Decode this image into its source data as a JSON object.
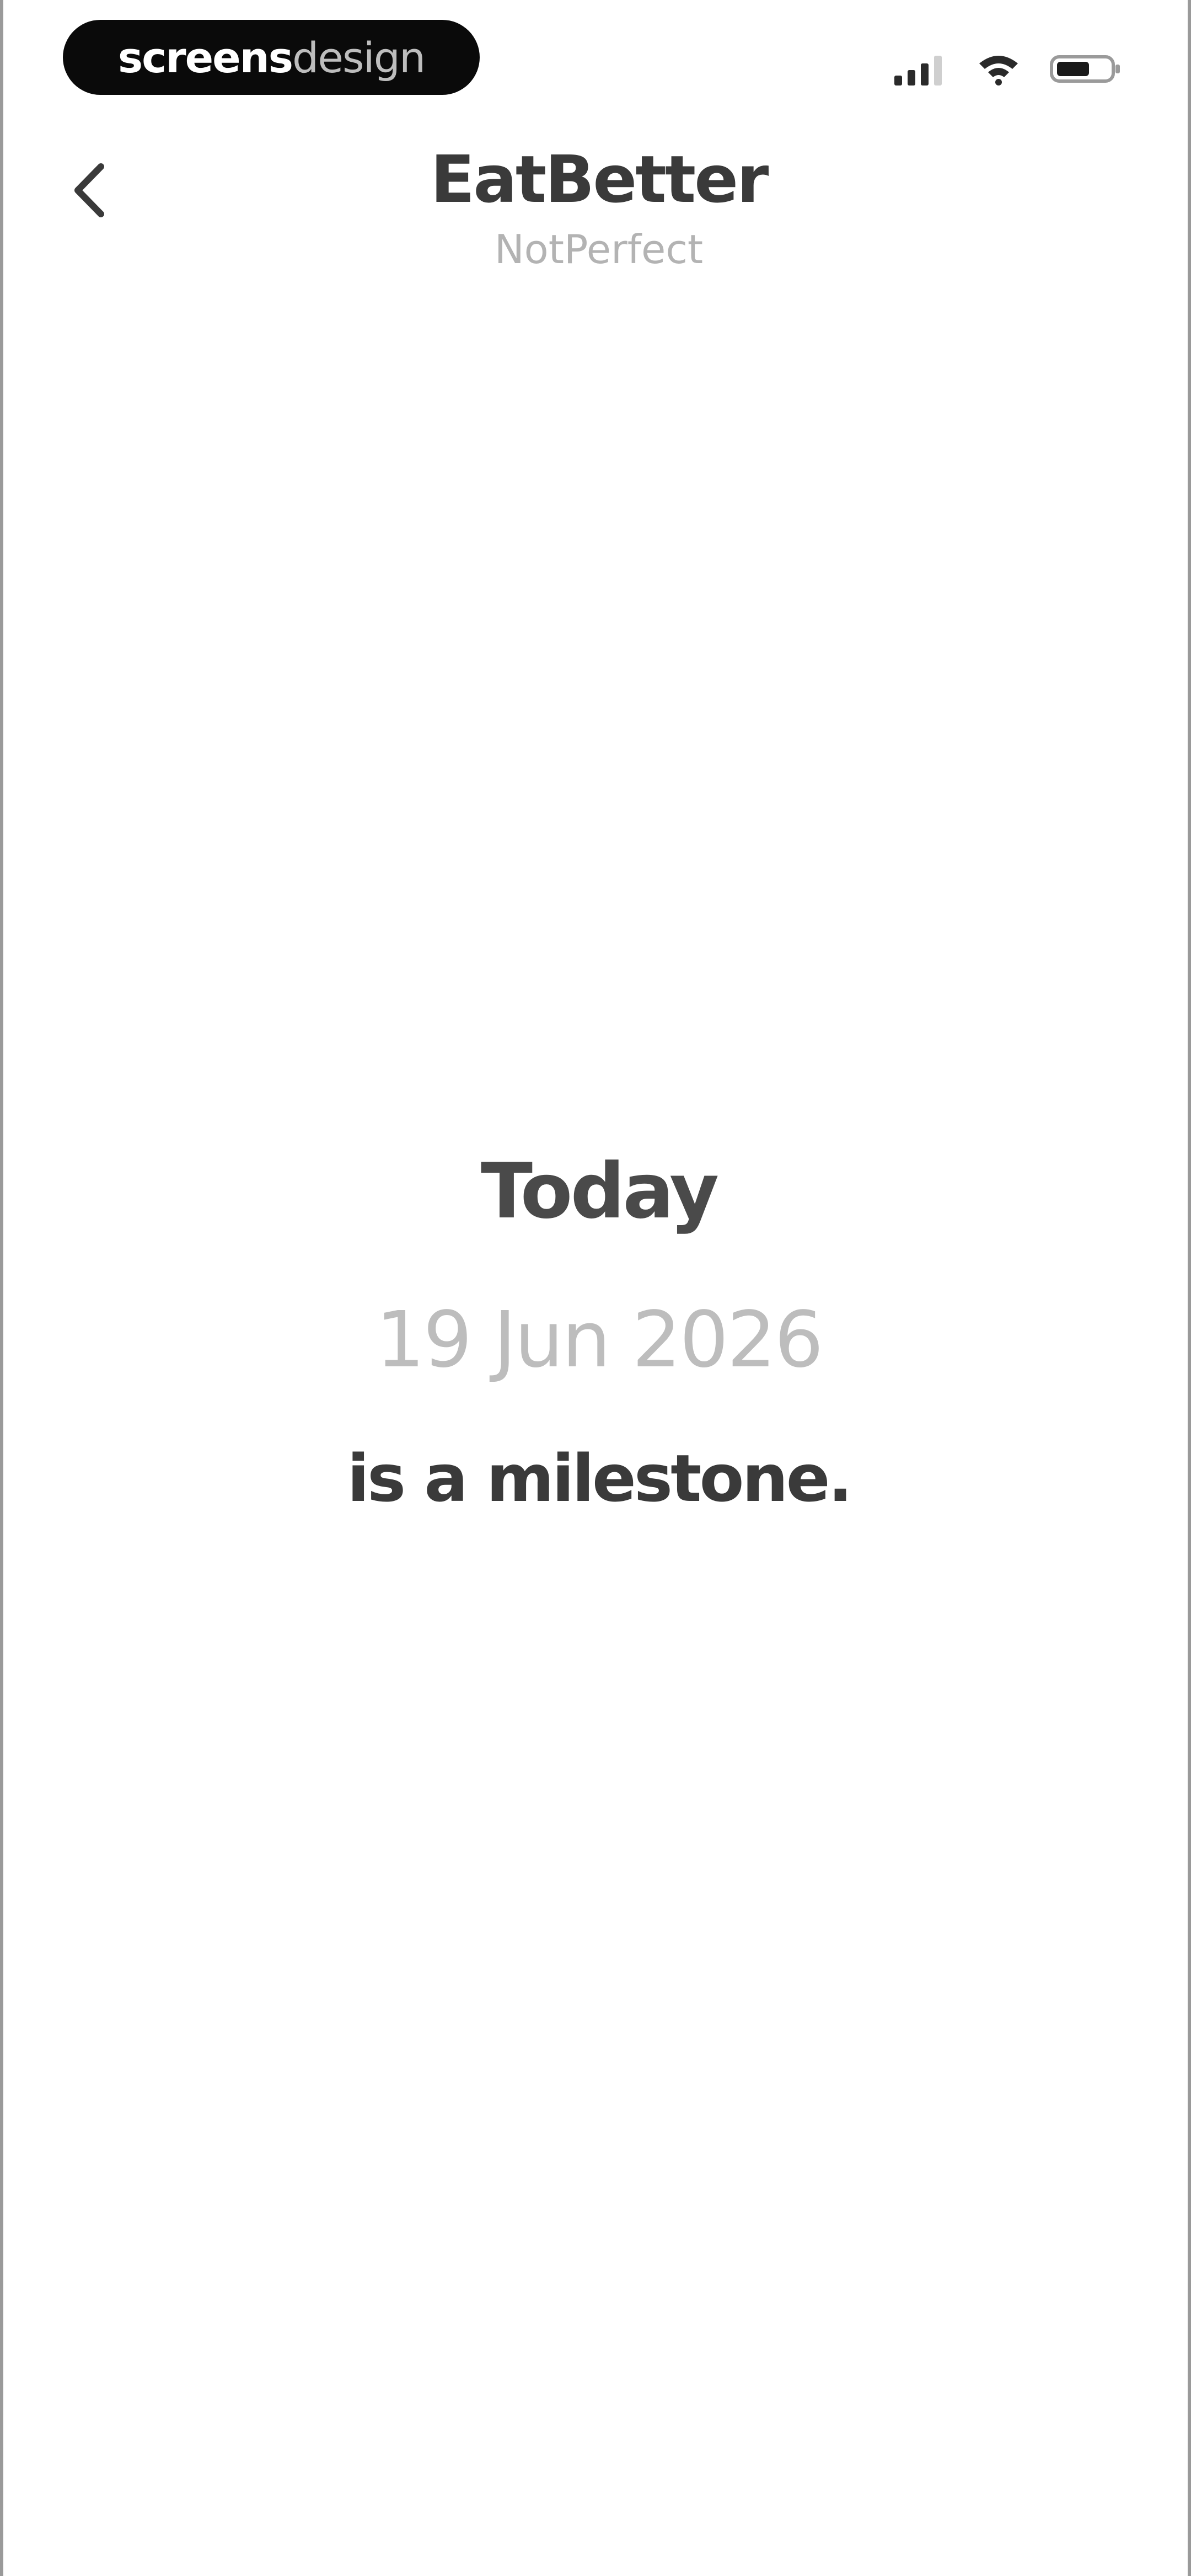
{
  "status_bar": {
    "brand": {
      "strong": "screens",
      "light": "design"
    },
    "icons": [
      "signal-icon",
      "wifi-icon",
      "battery-icon"
    ]
  },
  "header": {
    "back_icon": "chevron-left-icon",
    "title": "EatBetter",
    "subtitle": "NotPerfect"
  },
  "milestone": {
    "heading": "Today",
    "date": "19 Jun 2026",
    "caption": "is a milestone."
  },
  "colors": {
    "background": "#ffffff",
    "text_primary": "#3a3a3a",
    "text_muted": "#bdbdbd"
  }
}
